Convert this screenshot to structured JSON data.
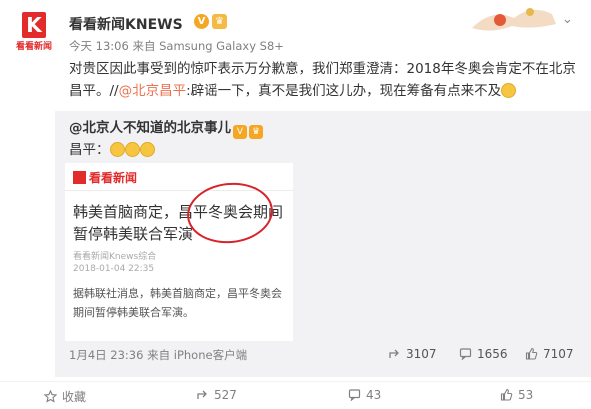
{
  "account": {
    "name": "看看新闻KNEWS",
    "logo_text": "K",
    "logo_brand": "看看新闻"
  },
  "post": {
    "time": "今天 13:06",
    "source_prefix": "来自",
    "source": "Samsung Galaxy S8+",
    "text_main": "对贵区因此事受到的惊吓表示万分歉意，我们郑重澄清：2018年冬奥会肯定不在北京昌平。//",
    "mention": "@北京昌平",
    "text_tail": ":辟谣一下，真不是我们这儿办，现在筹备有点来不及"
  },
  "repost": {
    "author": "@北京人不知道的北京事儿",
    "text": "昌平：",
    "card": {
      "brand": "看看新闻",
      "title": "韩美首脑商定，昌平冬奥会期间暂停韩美联合军演",
      "source_line": "看看新闻Knews综合",
      "date": "2018-01-04 22:35",
      "body": "据韩联社消息，韩美首脑商定，昌平冬奥会期间暂停韩美联合军演。"
    },
    "footer_time": "1月4日 23:36",
    "footer_source_prefix": "来自",
    "footer_source": "iPhone客户端",
    "stats": {
      "reposts": "3107",
      "comments": "1656",
      "likes": "7107"
    }
  },
  "actions": {
    "favorite": "收藏",
    "reposts": "527",
    "comments": "43",
    "likes": "53"
  },
  "colors": {
    "brand_red": "#e22b2b",
    "mention": "#eb7350",
    "circle_red": "#d8232a"
  }
}
